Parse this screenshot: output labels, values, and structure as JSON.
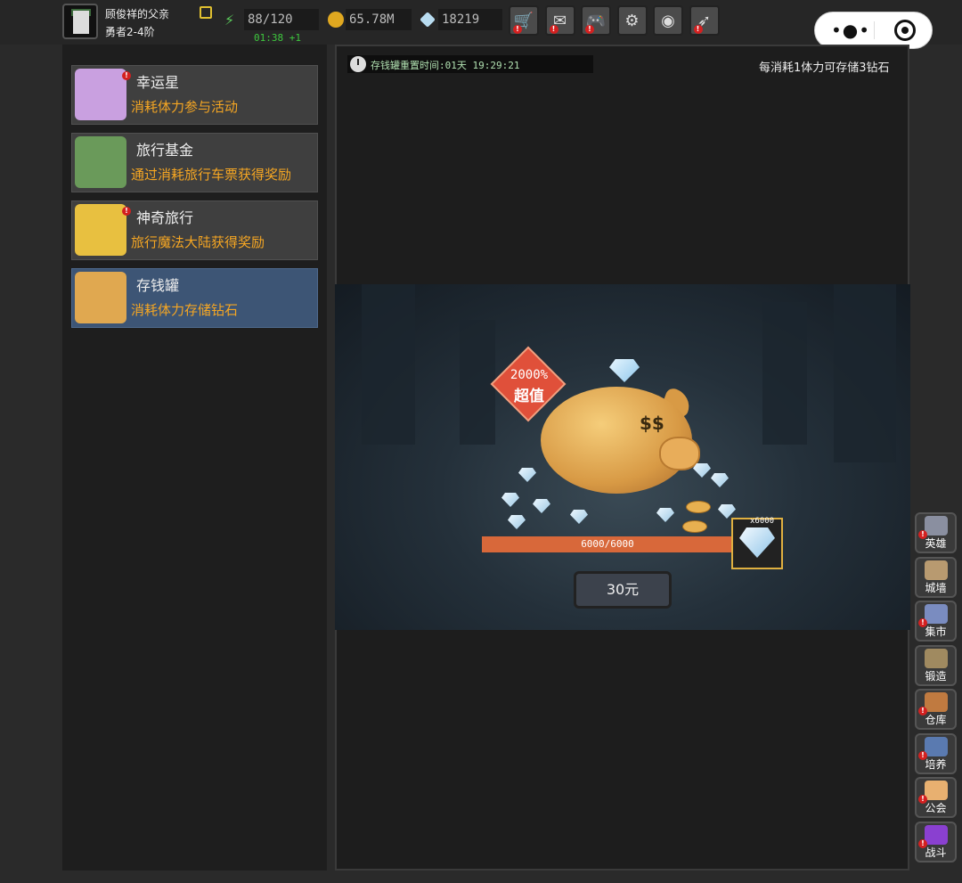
{
  "player": {
    "name": "顾俊祥的父亲",
    "rank": "勇者2-4阶"
  },
  "stats": {
    "energy": "88/120",
    "energy_timer": "01:38 +1",
    "gold": "65.78M",
    "gems": "18219"
  },
  "toolbar": {
    "buttons": [
      {
        "icon": "shop-cart-icon",
        "glyph": "🛒"
      },
      {
        "icon": "mail-icon",
        "glyph": "✉"
      },
      {
        "icon": "gamepad-icon",
        "glyph": "🎮"
      },
      {
        "icon": "settings-gear-icon",
        "glyph": "⚙"
      },
      {
        "icon": "color-wheel-icon",
        "glyph": "◉"
      },
      {
        "icon": "feather-icon",
        "glyph": "➶"
      }
    ]
  },
  "sidebar": {
    "items": [
      {
        "title": "幸运星",
        "desc": "消耗体力参与活动",
        "icon": "lucky-star-icon",
        "color": "#c9a0e0",
        "badge": true
      },
      {
        "title": "旅行基金",
        "desc": "通过消耗旅行车票获得奖励",
        "icon": "money-bag-icon",
        "color": "#6a9a5a",
        "badge": false
      },
      {
        "title": "神奇旅行",
        "desc": "旅行魔法大陆获得奖励",
        "icon": "travel-ticket-icon",
        "color": "#e8c040",
        "badge": true
      },
      {
        "title": "存钱罐",
        "desc": "消耗体力存储钻石",
        "icon": "piggy-bank-icon",
        "color": "#e0a850",
        "badge": false
      }
    ]
  },
  "piggy_bank": {
    "reset_timer": "存钱罐重置时间:01天 19:29:21",
    "description": "每消耗1体力可存储3钻石",
    "sale_percent": "2000%",
    "sale_label": "超值",
    "progress_text": "6000/6000",
    "progress_fraction": 1.0,
    "reward_quantity": "x6000",
    "price_label": "30元"
  },
  "side_nav": [
    {
      "label": "英雄",
      "icon": "hero-helmet-icon",
      "color": "#8a8fa0",
      "badge": true
    },
    {
      "label": "城墙",
      "icon": "city-wall-icon",
      "color": "#b89a70",
      "badge": false
    },
    {
      "label": "集市",
      "icon": "market-stall-icon",
      "color": "#7a8cc0",
      "badge": true
    },
    {
      "label": "锻造",
      "icon": "anvil-hammer-icon",
      "color": "#a08a60",
      "badge": false
    },
    {
      "label": "仓库",
      "icon": "warehouse-icon",
      "color": "#c07a40",
      "badge": true
    },
    {
      "label": "培养",
      "icon": "trophy-icon",
      "color": "#5a7ab0",
      "badge": true
    },
    {
      "label": "公会",
      "icon": "guild-icon",
      "color": "#e8b070",
      "badge": true
    },
    {
      "label": "战斗",
      "icon": "battle-portal-icon",
      "color": "#8a40d0",
      "badge": true
    }
  ]
}
